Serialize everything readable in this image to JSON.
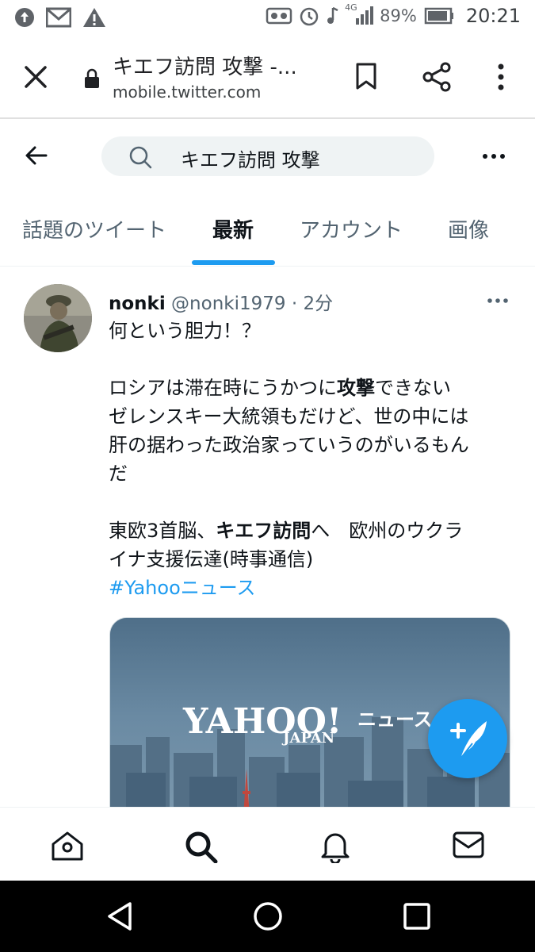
{
  "status_bar": {
    "battery_percent": "89%",
    "time": "20:21",
    "network_label": "4G",
    "left_icons": [
      "upload-icon",
      "gmail-icon",
      "warning-icon"
    ],
    "right_icons": [
      "voicemail-icon",
      "alarm-icon",
      "music-icon",
      "signal-icon",
      "battery-icon"
    ]
  },
  "browser": {
    "page_title": "キエフ訪問 攻撃 -...",
    "url": "mobile.twitter.com"
  },
  "search": {
    "query": "キエフ訪問 攻撃"
  },
  "tabs": [
    {
      "label": "話題のツイート",
      "active": false
    },
    {
      "label": "最新",
      "active": true
    },
    {
      "label": "アカウント",
      "active": false
    },
    {
      "label": "画像",
      "active": false
    }
  ],
  "tweet": {
    "display_name": "nonki",
    "handle": "@nonki1979",
    "separator": "·",
    "time": "2分",
    "line1": "何という胆力！？",
    "para2_part1": "ロシアは滞在時にうかつに",
    "para2_bold": "攻撃",
    "para2_part2": "できない",
    "para2_line2": "ゼレンスキー大統領もだけど、世の中には",
    "para2_line3": "肝の据わった政治家っていうのがいるもん",
    "para2_line4": "だ",
    "para3_part1": "東欧3首脳、",
    "para3_bold": "キエフ訪問",
    "para3_part2": "へ　欧州のウクラ",
    "para3_line2": "イナ支援伝達(時事通信)",
    "hashtag": "#Yahooニュース",
    "card": {
      "logo_main": "YAHOO!",
      "logo_sub": "JAPAN",
      "logo_news": "ニュース"
    }
  },
  "colors": {
    "accent": "#1d9bf0",
    "text_primary": "#0f1419",
    "text_secondary": "#536471",
    "search_bg": "#eff3f4"
  }
}
